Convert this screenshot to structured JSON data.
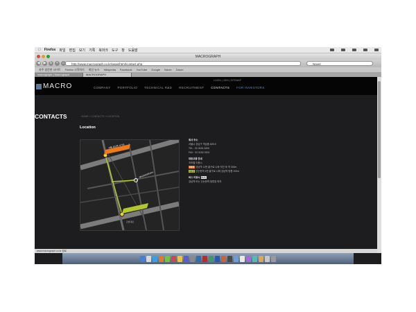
{
  "menubar": {
    "app": "Firefox",
    "items": [
      "파일",
      "편집",
      "보기",
      "기록",
      "북마크",
      "도구",
      "창",
      "도움말"
    ]
  },
  "window": {
    "title": "MACROGRAPH"
  },
  "toolbar": {
    "url": "http://www.macrograph.co.kr/www/html/contact.php",
    "search": "Naver"
  },
  "bookmarks": [
    "자주 방문한 사이트",
    "Firefox 시작하기",
    "최신 뉴스",
    "Wikipedia",
    "Facebook",
    "YouTube",
    "Google",
    "Naver",
    "Daum"
  ],
  "tabs": [
    {
      "label": "macrograph | Macrograph"
    },
    {
      "label": "MACROGRAPH"
    }
  ],
  "site": {
    "logo": "MACRO",
    "header_links": "LOGIN | JOIN | SITEMAP",
    "nav": [
      "COMPANY",
      "PORTFOLIO",
      "TECHNICAL R&D",
      "RECRUITMENT",
      "CONTACTS",
      "FOR INVESTORS"
    ],
    "page_title": "CONTACTS",
    "breadcrumb": "HOME > CONTACTS > LOCATION",
    "section": "Location",
    "map": {
      "label_top": "서울 강남역 사거리",
      "label_mid": "MACROGRAPH",
      "label_bottom": "신논현역 4번",
      "label_street": "강남대로"
    },
    "address": {
      "head": "회사 주소",
      "line1": "서울시 강남구 역삼동 825-8",
      "tel": "TEL : 02-3152-3200",
      "fax": "FAX : 02-3152-3201",
      "transit_head": "대중교통 안내",
      "subway_head": "지하철 이용시",
      "line2_tag": "2호선",
      "line2_text": "강남역 11번 출구로 나와 직진 후 약 300m",
      "line9_tag": "9호선",
      "line9_text": "신논현역 4번 출구로 나와 강남역 방향 200m",
      "bus_head": "버스 이용시",
      "bus_tag": "BUS",
      "bus_text": "강남역 또는 신논현역 정류장 하차"
    }
  },
  "statusbar": "www.macrograph.co.kr 완료",
  "colors": {
    "accent_orange": "#f07a1a",
    "accent_green": "#b2c82e",
    "nav_accent": "#4f8ad6"
  }
}
